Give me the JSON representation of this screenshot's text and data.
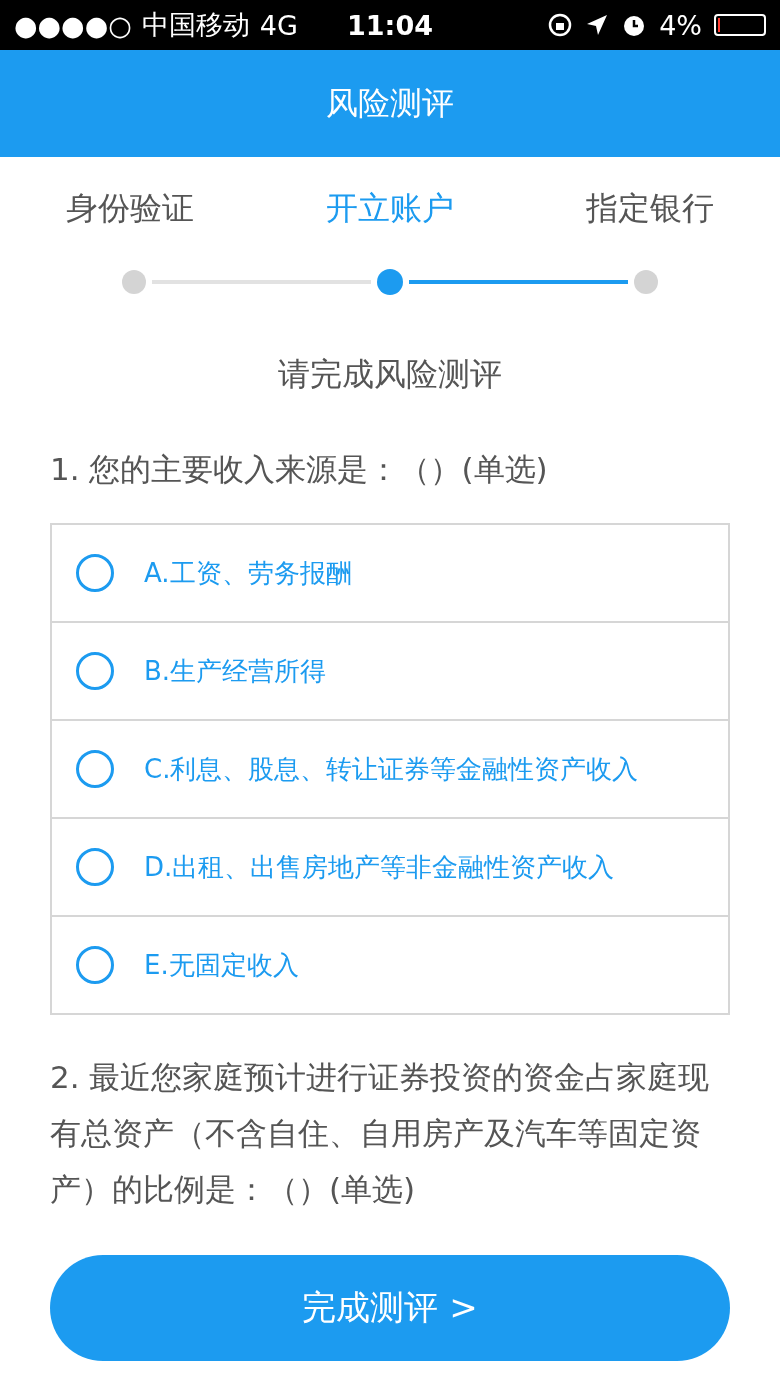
{
  "status_bar": {
    "signal": "●●●●○",
    "carrier": "中国移动",
    "network": "4G",
    "time": "11:04",
    "battery_text": "4%",
    "battery": {
      "level": 0.04
    }
  },
  "header": {
    "title": "风险测评"
  },
  "steps": [
    {
      "label": "身份验证",
      "current": false
    },
    {
      "label": "开立账户",
      "current": true
    },
    {
      "label": "指定银行",
      "current": false
    }
  ],
  "prompt": "请完成风险测评",
  "questions": [
    {
      "text": "1. 您的主要收入来源是：（）(单选)",
      "options": [
        {
          "label": "A.工资、劳务报酬",
          "selected": false
        },
        {
          "label": "B.生产经营所得",
          "selected": false
        },
        {
          "label": "C.利息、股息、转让证券等金融性资产收入",
          "selected": false
        },
        {
          "label": "D.出租、出售房地产等非金融性资产收入",
          "selected": false
        },
        {
          "label": "E.无固定收入",
          "selected": false
        }
      ]
    },
    {
      "text": "2. 最近您家庭预计进行证券投资的资金占家庭现有总资产（不含自住、自用房产及汽车等固定资产）的比例是：（）(单选)"
    }
  ],
  "submit_button": "完成测评 >"
}
